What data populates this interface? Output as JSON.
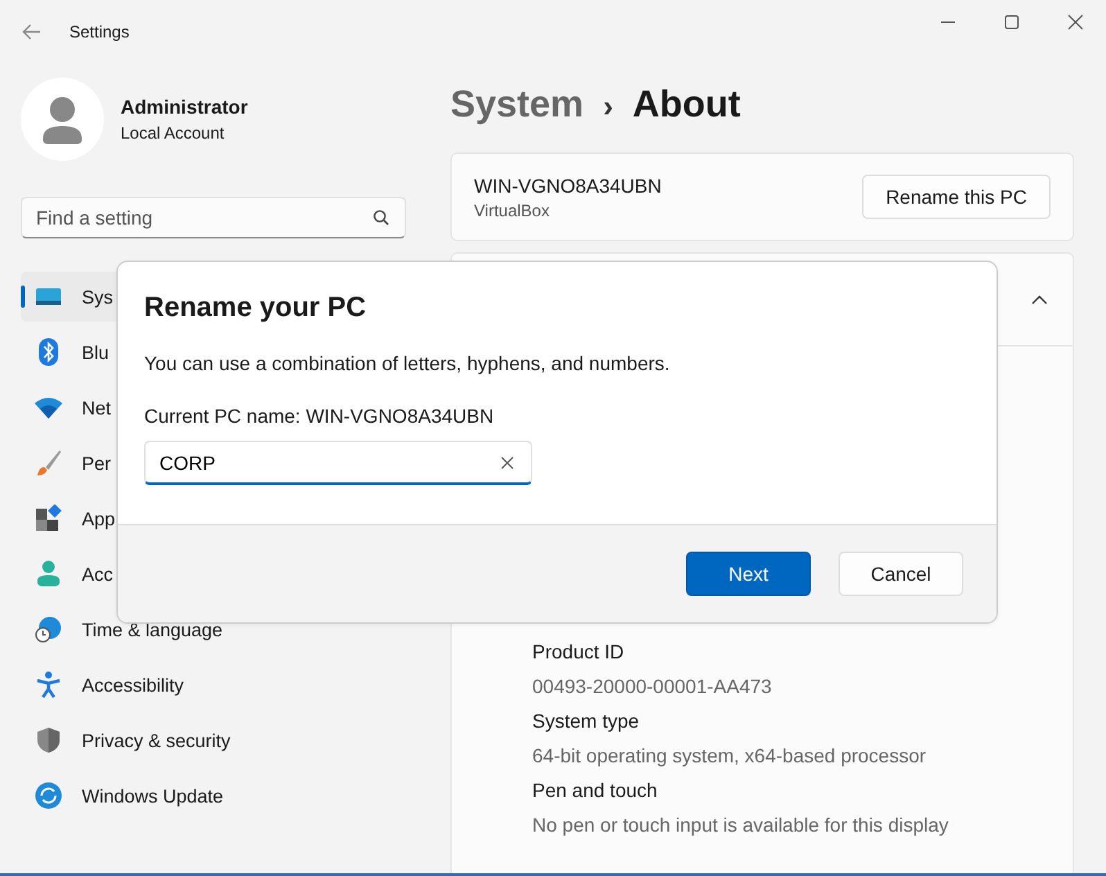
{
  "window": {
    "title": "Settings"
  },
  "account": {
    "name": "Administrator",
    "type": "Local Account"
  },
  "search": {
    "placeholder": "Find a setting"
  },
  "nav": [
    {
      "label": "Sys",
      "selected": true
    },
    {
      "label": "Blu",
      "selected": false
    },
    {
      "label": "Net",
      "selected": false
    },
    {
      "label": "Per",
      "selected": false
    },
    {
      "label": "App",
      "selected": false
    },
    {
      "label": "Acc",
      "selected": false
    },
    {
      "label": "Time & language",
      "selected": false
    },
    {
      "label": "Accessibility",
      "selected": false
    },
    {
      "label": "Privacy & security",
      "selected": false
    },
    {
      "label": "Windows Update",
      "selected": false
    }
  ],
  "breadcrumb": {
    "parent": "System",
    "separator": "›",
    "current": "About"
  },
  "pc_card": {
    "name": "WIN-VGNO8A34UBN",
    "model": "VirtualBox",
    "button": "Rename this PC"
  },
  "specs_card": {
    "expanded": true,
    "rows": [
      {
        "label": "Product ID",
        "value": "00493-20000-00001-AA473"
      },
      {
        "label": "System type",
        "value": "64-bit operating system, x64-based processor"
      },
      {
        "label": "Pen and touch",
        "value": "No pen or touch input is available for this display"
      }
    ]
  },
  "dialog": {
    "title": "Rename your PC",
    "message": "You can use a combination of letters, hyphens, and numbers.",
    "current_name": "Current PC name: WIN-VGNO8A34UBN",
    "field_value": "CORP",
    "primary_button": "Next",
    "secondary_button": "Cancel"
  }
}
